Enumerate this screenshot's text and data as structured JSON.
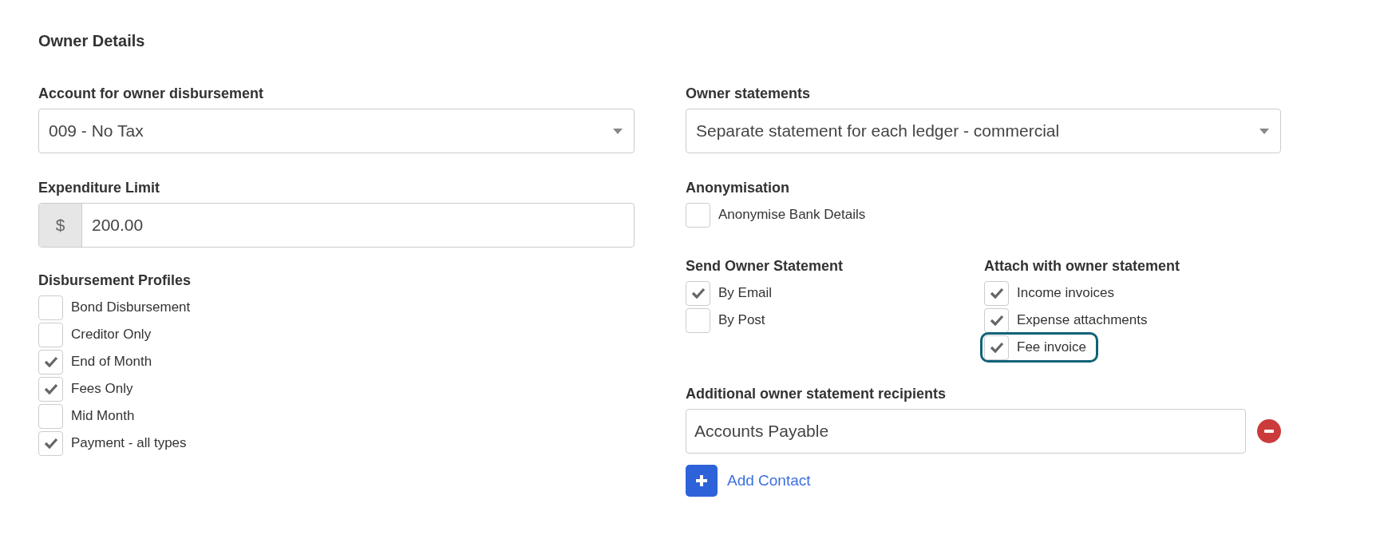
{
  "heading": "Owner Details",
  "left": {
    "account": {
      "label": "Account for owner disbursement",
      "value": "009 - No Tax"
    },
    "expenditure": {
      "label": "Expenditure Limit",
      "prefix": "$",
      "value": "200.00"
    },
    "profiles": {
      "label": "Disbursement Profiles",
      "items": [
        {
          "label": "Bond Disbursement",
          "checked": false
        },
        {
          "label": "Creditor Only",
          "checked": false
        },
        {
          "label": "End of Month",
          "checked": true
        },
        {
          "label": "Fees Only",
          "checked": true
        },
        {
          "label": "Mid Month",
          "checked": false
        },
        {
          "label": "Payment - all types",
          "checked": true
        }
      ]
    }
  },
  "right": {
    "statements": {
      "label": "Owner statements",
      "value": "Separate statement for each ledger - commercial"
    },
    "anonymisation": {
      "label": "Anonymisation",
      "items": [
        {
          "label": "Anonymise Bank Details",
          "checked": false
        }
      ]
    },
    "send": {
      "label": "Send Owner Statement",
      "items": [
        {
          "label": "By Email",
          "checked": true
        },
        {
          "label": "By Post",
          "checked": false
        }
      ]
    },
    "attach": {
      "label": "Attach with owner statement",
      "items": [
        {
          "label": "Income invoices",
          "checked": true,
          "highlighted": false
        },
        {
          "label": "Expense attachments",
          "checked": true,
          "highlighted": false
        },
        {
          "label": "Fee invoice",
          "checked": true,
          "highlighted": true
        }
      ]
    },
    "recipients": {
      "label": "Additional owner statement recipients",
      "items": [
        {
          "value": "Accounts Payable"
        }
      ],
      "add_label": "Add Contact"
    }
  }
}
